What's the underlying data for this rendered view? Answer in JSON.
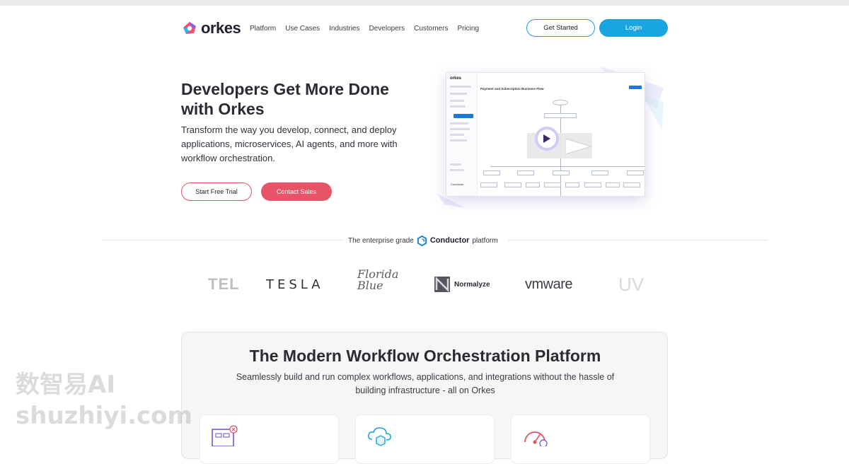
{
  "header": {
    "logo_text": "orkes",
    "nav": [
      "Platform",
      "Use Cases",
      "Industries",
      "Developers",
      "Customers",
      "Pricing"
    ],
    "get_started_label": "Get Started",
    "login_label": "Login"
  },
  "hero": {
    "title": "Developers Get More Done with Orkes",
    "subtitle": "Transform the way you develop, connect, and deploy applications, microservices, AI agents, and more with workflow orchestration.",
    "trial_label": "Start Free Trial",
    "sales_label": "Contact Sales"
  },
  "preview": {
    "logo": "orkes",
    "workflow_title": "Payment and Subscription Business Flow",
    "footer_label": "Conductor"
  },
  "divider": {
    "prefix": "The enterprise grade",
    "brand": "Conductor",
    "suffix": "platform"
  },
  "customers": {
    "tel": "TEL",
    "tesla": "TESLA",
    "florida_line1": "Florida",
    "florida_line2": "Blue",
    "normalyze": "Normalyze",
    "vmware": "vmware",
    "uv": "UV"
  },
  "platform": {
    "title": "The Modern Workflow Orchestration Platform",
    "subtitle": "Seamlessly build and run complex workflows, applications, and integrations without the hassle of building infrastructure - all on Orkes"
  },
  "watermark": {
    "line1": "数智易AI",
    "line2": "shuzhiyi.com"
  },
  "colors": {
    "accent_blue": "#19a6e0",
    "accent_red": "#e85568",
    "brand_purple": "#7b4fe0"
  }
}
